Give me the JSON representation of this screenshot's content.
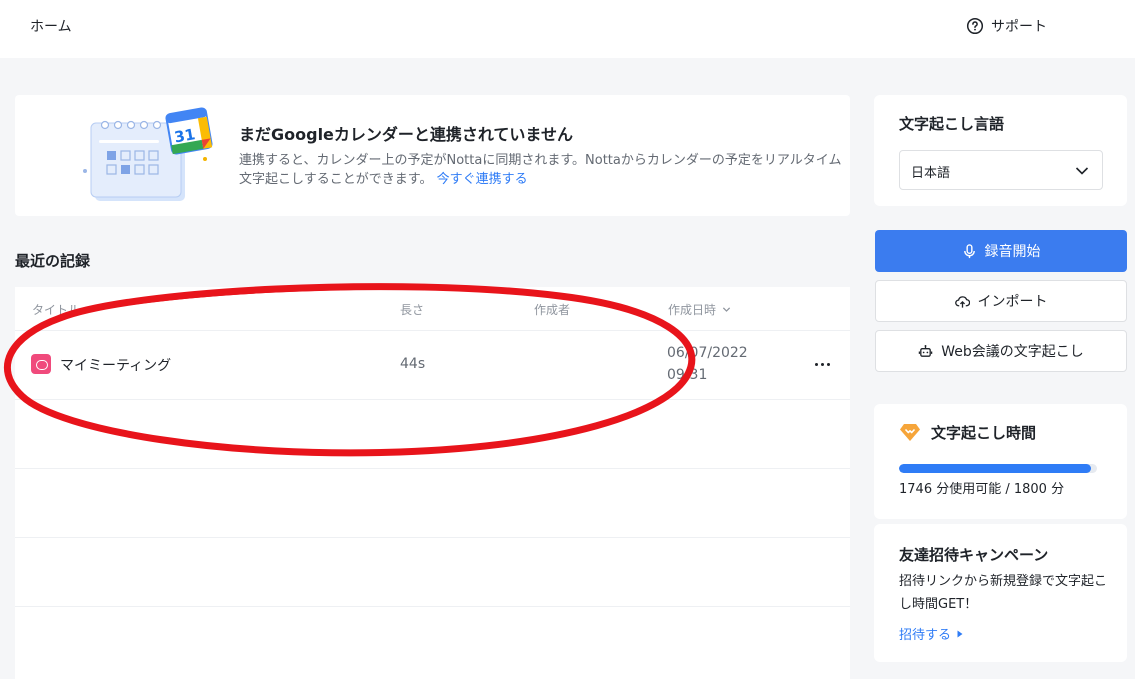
{
  "topbar": {
    "home": "ホーム",
    "support": "サポート",
    "support_icon": "question-circle-icon"
  },
  "banner": {
    "title": "まだGoogleカレンダーと連携されていません",
    "description": "連携すると、カレンダー上の予定がNottaに同期されます。Nottaからカレンダーの予定をリアルタイム文字起こしすることができます。",
    "link": "今すぐ連携する",
    "calendar_day": "31",
    "illustration_icon": "google-calendar-icon"
  },
  "recent": {
    "title": "最近の記録",
    "columns": [
      "タイトル",
      "長さ",
      "作成者",
      "作成日時"
    ],
    "rows": [
      {
        "title": "マイミーティング",
        "length": "44s",
        "author": "",
        "date": "06/07/2022",
        "time": "09:31",
        "icon": "recording-icon",
        "more_icon": "more-dots-icon"
      }
    ]
  },
  "language": {
    "title": "文字起こし言語",
    "selected": "日本語",
    "icon": "chevron-down-icon"
  },
  "actions": {
    "record": "録音開始",
    "import": "インポート",
    "web_meeting": "Web会議の文字起こし",
    "record_icon": "microphone-icon",
    "import_icon": "cloud-upload-icon",
    "web_icon": "robot-icon"
  },
  "transcription_time": {
    "title": "文字起こし時間",
    "icon": "diamond-icon",
    "available": 1746,
    "total": 1800,
    "usage_text": "1746 分使用可能 / 1800 分"
  },
  "invite": {
    "title": "友達招待キャンペーン",
    "description": "招待リンクから新規登録で文字起こし時間GET！",
    "link": "招待する",
    "link_icon": "caret-right-icon"
  },
  "colors": {
    "primary": "#3b7cef",
    "link": "#2f7cf6",
    "annotation": "#e8141b",
    "recording_icon": "#f04a7c",
    "diamond": "#f6a53a"
  }
}
